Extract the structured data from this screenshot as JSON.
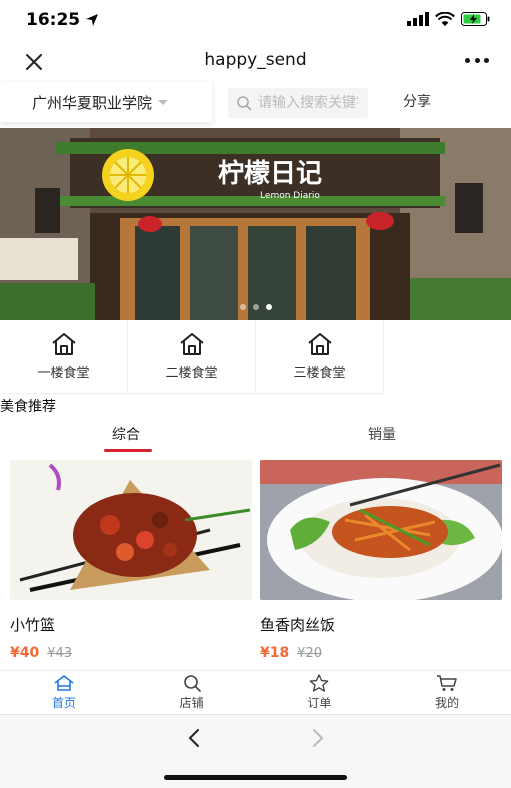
{
  "status": {
    "time": "16:25"
  },
  "nav": {
    "title": "happy_send"
  },
  "location": {
    "school": "广州华夏职业学院"
  },
  "search": {
    "placeholder": "请输入搜索关键字"
  },
  "share_label": "分享",
  "banner": {
    "sign_text": "柠檬日记",
    "sign_sub": "Lemon Diario",
    "slides": 3,
    "active_slide": 2
  },
  "categories": [
    {
      "label": "一楼食堂",
      "icon": "home-icon"
    },
    {
      "label": "二楼食堂",
      "icon": "home-icon"
    },
    {
      "label": "三楼食堂",
      "icon": "home-icon"
    }
  ],
  "section_title": "美食推荐",
  "sort_tabs": [
    {
      "label": "综合",
      "active": true
    },
    {
      "label": "销量",
      "active": false
    }
  ],
  "products": [
    {
      "name": "小竹篮",
      "price": "¥40",
      "old_price": "¥43"
    },
    {
      "name": "鱼香肉丝饭",
      "price": "¥18",
      "old_price": "¥20"
    }
  ],
  "tabbar": [
    {
      "label": "首页",
      "icon": "home-icon",
      "active": true
    },
    {
      "label": "店铺",
      "icon": "search-icon",
      "active": false
    },
    {
      "label": "订单",
      "icon": "star-icon",
      "active": false
    },
    {
      "label": "我的",
      "icon": "cart-icon",
      "active": false
    }
  ],
  "colors": {
    "accent_red": "#d8222e",
    "price_orange": "#f26a35",
    "active_blue": "#1e78e6"
  }
}
